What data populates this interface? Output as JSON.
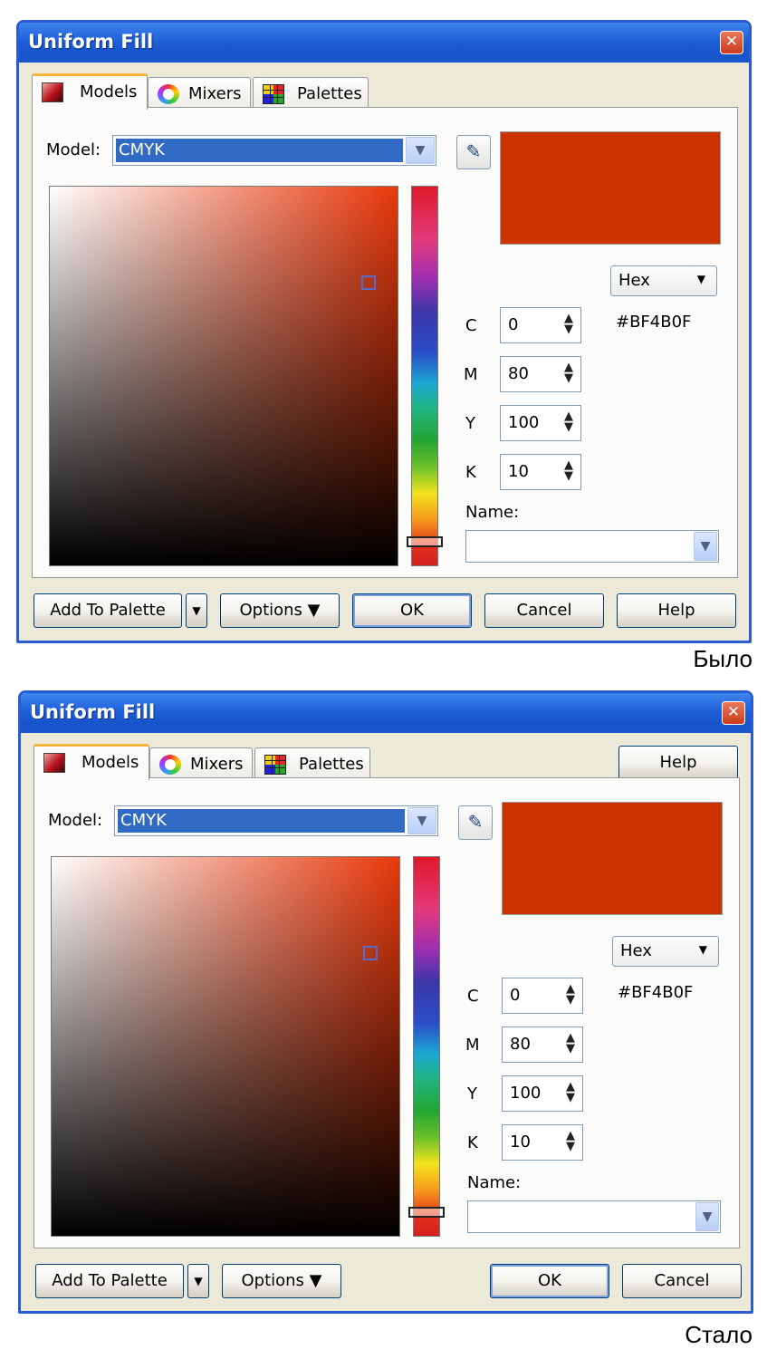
{
  "dialog": {
    "title": "Uniform Fill",
    "close_glyph": "✕",
    "tabs": [
      {
        "label": "Models",
        "icon": "models-icon"
      },
      {
        "label": "Mixers",
        "icon": "mixers-icon"
      },
      {
        "label": "Palettes",
        "icon": "palettes-icon"
      }
    ],
    "model_label": "Model:",
    "model_value": "CMYK",
    "preview_color": "#cc3300",
    "hex_mode": "Hex",
    "hex_value": "#BF4B0F",
    "cmyk": [
      {
        "label": "C",
        "value": "0"
      },
      {
        "label": "M",
        "value": "80"
      },
      {
        "label": "Y",
        "value": "100"
      },
      {
        "label": "K",
        "value": "10"
      }
    ],
    "name_label": "Name:",
    "name_value": "",
    "buttons": {
      "add_to_palette": "Add To Palette",
      "options": "Options ▼",
      "ok": "OK",
      "cancel": "Cancel",
      "help": "Help"
    }
  },
  "captions": {
    "before": "Было",
    "after": "Стало"
  }
}
